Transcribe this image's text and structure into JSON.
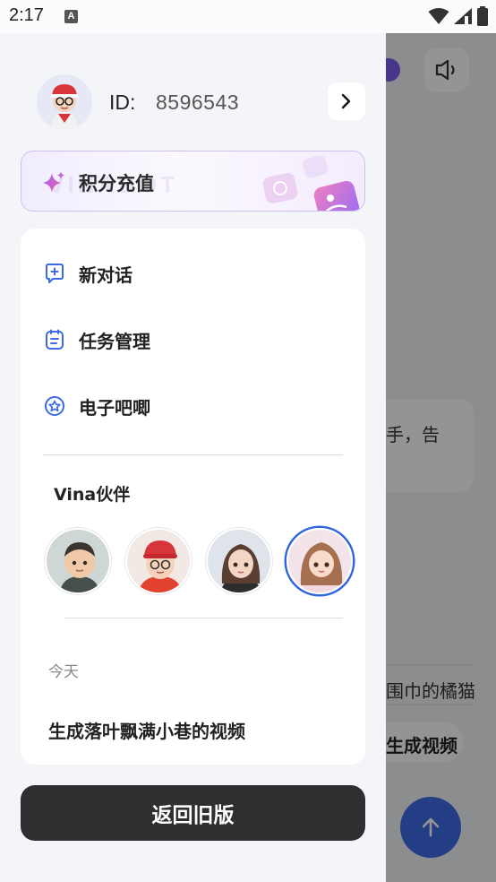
{
  "status_bar": {
    "time": "2:17",
    "notification": "A"
  },
  "drawer": {
    "profile": {
      "id_label": "ID:",
      "id_value": "8596543"
    },
    "recharge_label": "积分充值",
    "recharge_watermark": "VINABOT",
    "menu": [
      {
        "label": "新对话",
        "icon": "new-chat-icon"
      },
      {
        "label": "任务管理",
        "icon": "task-icon"
      },
      {
        "label": "电子吧唧",
        "icon": "badge-icon"
      }
    ],
    "partners_title": "Vina伙伴",
    "partners": [
      {
        "name": "partner-1",
        "selected": false
      },
      {
        "name": "partner-2",
        "selected": false
      },
      {
        "name": "partner-3",
        "selected": false
      },
      {
        "name": "partner-4",
        "selected": true
      }
    ],
    "history_group": "今天",
    "history_items": [
      "生成落叶飘满小巷的视频"
    ],
    "back_button": "返回旧版"
  },
  "background": {
    "bubble_text": "手，告",
    "suggestion_1": "围巾的橘猫",
    "suggestion_2": "生成视频"
  },
  "colors": {
    "accent": "#2f66e0",
    "purple": "#7a5cf0",
    "dark_button": "#2f2f31"
  }
}
